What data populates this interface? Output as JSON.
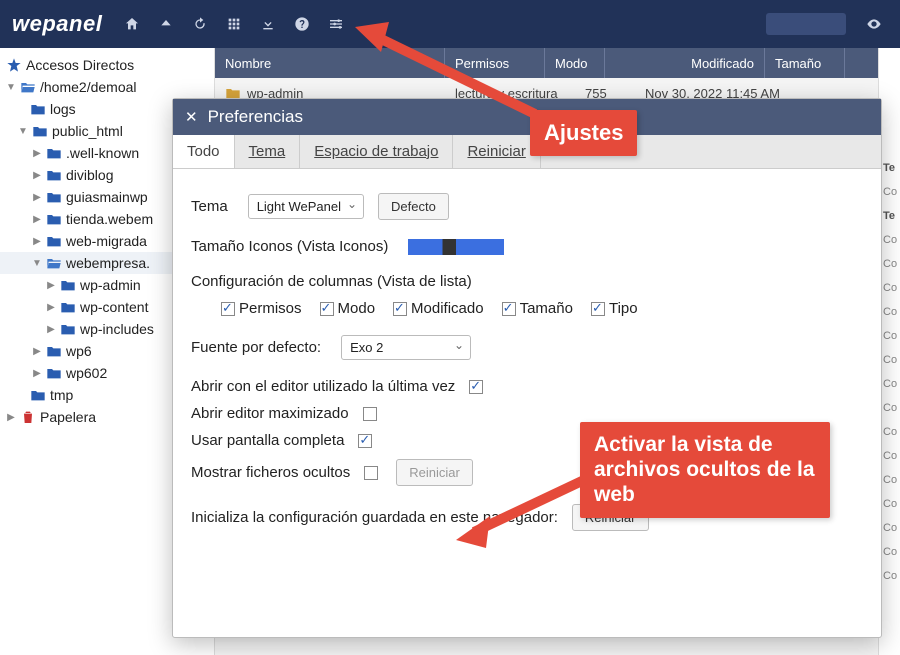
{
  "brand": "wepanel",
  "sidebar": {
    "shortcuts": "Accesos Directos",
    "root": "/home2/demoal",
    "logs": "logs",
    "public_html": "public_html",
    "wellknown": ".well-known",
    "diviblog": "diviblog",
    "guiasmainwp": "guiasmainwp",
    "tienda": "tienda.webem",
    "webmigrada": "web-migrada",
    "webempresa": "webempresa.",
    "wpadmin": "wp-admin",
    "wpcontent": "wp-content",
    "wpincludes": "wp-includes",
    "wp6": "wp6",
    "wp602": "wp602",
    "tmp": "tmp",
    "papelera": "Papelera"
  },
  "table": {
    "col_nombre": "Nombre",
    "col_permisos": "Permisos",
    "col_modo": "Modo",
    "col_modificado": "Modificado",
    "col_tamano": "Tamaño",
    "row1_name": "wp-admin",
    "row1_perm": "lectura y escritura",
    "row1_mode": "755",
    "row1_mod": "Nov 30, 2022 11:45 AM"
  },
  "rightcol": {
    "hdr": "Te",
    "c": "Co"
  },
  "modal": {
    "title": "Preferencias",
    "tab_todo": "Todo",
    "tab_tema": "Tema",
    "tab_espacio": "Espacio de trabajo",
    "tab_reiniciar": "Reiniciar",
    "tema_label": "Tema",
    "tema_value": "Light WePanel",
    "defecto_btn": "Defecto",
    "iconsize_label": "Tamaño Iconos (Vista Iconos)",
    "colconfig_label": "Configuración de columnas (Vista de lista)",
    "col_permisos": "Permisos",
    "col_modo": "Modo",
    "col_modificado": "Modificado",
    "col_tamano": "Tamaño",
    "col_tipo": "Tipo",
    "font_label": "Fuente por defecto:",
    "font_value": "Exo 2",
    "lasteditor_label": "Abrir con el editor utilizado la última vez",
    "maxeditor_label": "Abrir editor maximizado",
    "fullscreen_label": "Usar pantalla completa",
    "hidden_label": "Mostrar ficheros ocultos",
    "hidden_btn": "Reiniciar",
    "init_label": "Inicializa la configuración guardada en este navegador:",
    "init_btn": "Reiniciar"
  },
  "callouts": {
    "ajustes": "Ajustes",
    "hidden": "Activar la vista de archivos ocultos de la web"
  }
}
